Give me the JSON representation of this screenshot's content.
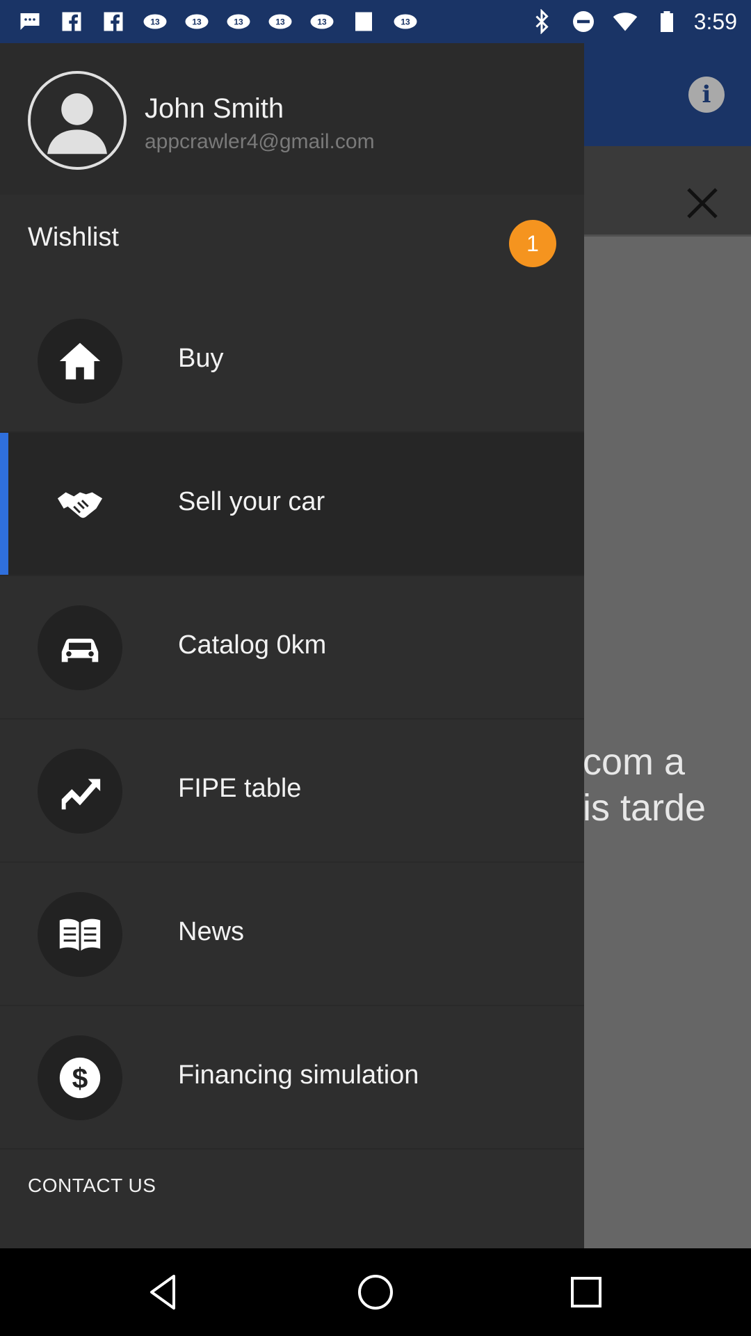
{
  "status_bar": {
    "time": "3:59",
    "left_icons": [
      "message-icon",
      "facebook-icon",
      "facebook-icon",
      "news-13-icon",
      "news-13-icon",
      "news-13-icon",
      "news-13-icon",
      "news-13-icon",
      "square-icon",
      "news-13-icon"
    ],
    "right_icons": [
      "bluetooth-icon",
      "do-not-disturb-icon",
      "wifi-icon",
      "battery-icon"
    ]
  },
  "app_background": {
    "text_line_1": "com a",
    "text_line_2": "is tarde"
  },
  "drawer": {
    "user": {
      "name": "John Smith",
      "email": "appcrawler4@gmail.com"
    },
    "wishlist": {
      "label": "Wishlist",
      "count": "1"
    },
    "items": [
      {
        "label": "Buy",
        "icon": "home-icon"
      },
      {
        "label": "Sell your car",
        "icon": "handshake-icon",
        "active": true
      },
      {
        "label": "Catalog 0km",
        "icon": "car-icon"
      },
      {
        "label": "FIPE table",
        "icon": "chart-up-icon"
      },
      {
        "label": "News",
        "icon": "book-icon"
      },
      {
        "label": "Financing simulation",
        "icon": "dollar-icon"
      }
    ],
    "contact_label": "CONTACT US"
  },
  "colors": {
    "toolbar": "#1a3466",
    "drawer": "#2e2e2e",
    "badge": "#f5941f",
    "active_indicator": "#2f6fdc"
  }
}
